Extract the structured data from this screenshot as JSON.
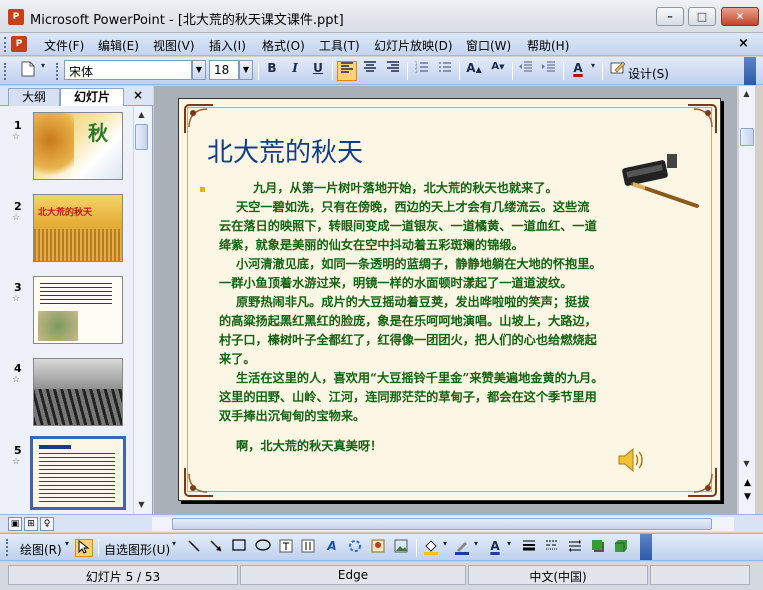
{
  "window": {
    "title": "Microsoft PowerPoint - [北大荒的秋天课文课件.ppt]",
    "min": "–",
    "max": "□",
    "close": "✕"
  },
  "menu": {
    "items": [
      "文件(F)",
      "编辑(E)",
      "视图(V)",
      "插入(I)",
      "格式(O)",
      "工具(T)",
      "幻灯片放映(D)",
      "窗口(W)",
      "帮助(H)"
    ],
    "close": "×"
  },
  "toolbar": {
    "font_name": "宋体",
    "font_size": "18",
    "bold": "B",
    "italic": "I",
    "underline": "U",
    "design_label": "设计(S)"
  },
  "left_pane": {
    "tabs": [
      "大纲",
      "幻灯片"
    ],
    "close": "×",
    "thumbnails": [
      {
        "number": "1",
        "text": "秋"
      },
      {
        "number": "2",
        "text": "北大荒的秋天"
      },
      {
        "number": "3",
        "text": ""
      },
      {
        "number": "4",
        "text": ""
      },
      {
        "number": "5",
        "text": ""
      }
    ]
  },
  "slide": {
    "title": "北大荒的秋天",
    "paragraphs": [
      "        九月，从第一片树叶落地开始，北大荒的秋天也就来了。",
      "    天空一碧如洗，只有在傍晚，西边的天上才会有几缕流云。这些流",
      "云在落日的映照下，转眼间变成一道银灰、一道橘黄、一道血红、一道",
      "绛紫，就象是美丽的仙女在空中抖动着五彩斑斓的锦缎。",
      "    小河清澈见底，如同一条透明的蓝绸子，静静地躺在大地的怀抱里。",
      "一群小鱼顶着水游过来，明镜一样的水面顿时漾起了一道道波纹。",
      "    原野热闹非凡。成片的大豆摇动着豆荚，发出哗啦啦的笑声；挺拔",
      "的高粱扬起黑红黑红的脸庞，象是在乐呵呵地演唱。山坡上，大路边，",
      "村子口，榛树叶子全都红了，红得像一团团火，把人们的心也给燃烧起",
      "来了。",
      "    生活在这里的人，喜欢用“大豆摇铃千里金”来赞美遍地金黄的九月。",
      "这里的田野、山岭、江河，连同那茫茫的草甸子，都会在这个季节里用",
      "双手捧出沉甸甸的宝物来。",
      "    啊，北大荒的秋天真美呀！"
    ]
  },
  "drawing_toolbar": {
    "draw_label": "绘图(R)",
    "autoshape_label": "自选图形(U)"
  },
  "status": {
    "slide_info": "幻灯片 5 / 53",
    "template": "Edge",
    "language": "中文(中国)"
  },
  "colors": {
    "title_color": "#143c8c",
    "body_color": "#136313",
    "slide_bg": "#fbf7e4"
  }
}
